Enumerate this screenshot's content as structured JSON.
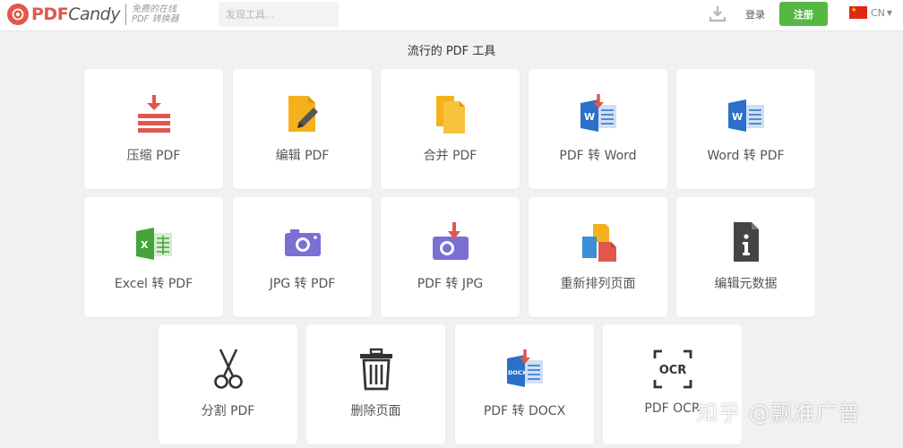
{
  "header": {
    "logo_text": "PDF",
    "logo_text_candy": "Candy",
    "tagline_line1": "免费的在线",
    "tagline_line2": "PDF 转换器",
    "search_placeholder": "发现工具...",
    "login_label": "登录",
    "signup_label": "注册",
    "language": "CN",
    "brand_color": "#e2574c",
    "signup_color": "#56b843"
  },
  "section": {
    "title": "流行的 PDF 工具"
  },
  "tools": [
    {
      "label": "压缩 PDF",
      "icon": "compress-icon"
    },
    {
      "label": "编辑 PDF",
      "icon": "edit-icon"
    },
    {
      "label": "合并 PDF",
      "icon": "merge-icon"
    },
    {
      "label": "PDF 转 Word",
      "icon": "pdf-to-word-icon"
    },
    {
      "label": "Word 转 PDF",
      "icon": "word-to-pdf-icon"
    },
    {
      "label": "Excel 转 PDF",
      "icon": "excel-to-pdf-icon"
    },
    {
      "label": "JPG 转 PDF",
      "icon": "jpg-to-pdf-icon"
    },
    {
      "label": "PDF 转 JPG",
      "icon": "pdf-to-jpg-icon"
    },
    {
      "label": "重新排列页面",
      "icon": "rearrange-pages-icon"
    },
    {
      "label": "编辑元数据",
      "icon": "edit-metadata-icon"
    },
    {
      "label": "分割 PDF",
      "icon": "scissors-icon"
    },
    {
      "label": "删除页面",
      "icon": "trash-icon"
    },
    {
      "label": "PDF 转 DOCX",
      "icon": "pdf-to-docx-icon"
    },
    {
      "label": "PDF OCR",
      "icon": "ocr-icon"
    }
  ],
  "watermark": "知乎 @飘准广普"
}
